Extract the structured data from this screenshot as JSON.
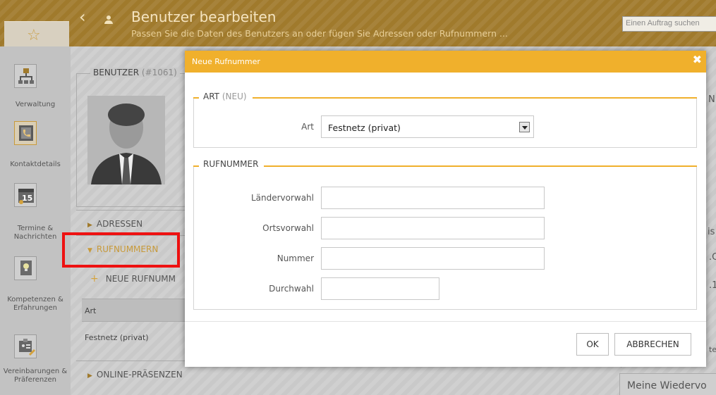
{
  "header": {
    "title": "Benutzer bearbeiten",
    "subtitle": "Passen Sie die Daten des Benutzers an oder fügen Sie Adressen oder Rufnummern ...",
    "search_placeholder": "Einen Auftrag suchen"
  },
  "sidebar": {
    "items": [
      {
        "label": "Verwaltung",
        "icon": "org-chart-icon"
      },
      {
        "label": "Kontaktdetails",
        "icon": "phone-book-icon"
      },
      {
        "label": "Termine & Nachrichten",
        "icon": "calendar-icon"
      },
      {
        "label": "Kompetenzen & Erfahrungen",
        "icon": "lightbulb-icon"
      },
      {
        "label": "Vereinbarungen & Präferenzen",
        "icon": "id-card-icon"
      }
    ]
  },
  "user_panel": {
    "label": "BENUTZER",
    "id": "(#1061)",
    "sections": {
      "adressen": "ADRESSEN",
      "rufnummern": "RUFNUMMERN",
      "online": "ONLINE-PRÄSENZEN"
    },
    "new_phone_label": "NEUE RUFNUMM",
    "table_header": "Art",
    "table_value": "Festnetz (privat)"
  },
  "right_panel": {
    "fragment_1": "NI",
    "fragment_2": "is",
    "fragment_3": ".C",
    "fragment_4": ".1",
    "fragment_5": "te",
    "bottom_label": "Meine Wiedervo"
  },
  "modal": {
    "title": "Neue Rufnummer",
    "section_art": {
      "title": "ART",
      "badge": "(NEU)"
    },
    "art_label": "Art",
    "art_value": "Festnetz (privat)",
    "section_rufnummer": {
      "title": "RUFNUMMER"
    },
    "fields": {
      "laendervorwahl": {
        "label": "Ländervorwahl",
        "value": ""
      },
      "ortsvorwahl": {
        "label": "Ortsvorwahl",
        "value": ""
      },
      "nummer": {
        "label": "Nummer",
        "value": ""
      },
      "durchwahl": {
        "label": "Durchwahl",
        "value": ""
      }
    },
    "ok_label": "OK",
    "cancel_label": "ABBRECHEN"
  },
  "colors": {
    "accent": "#f0b02c",
    "header_bg": "#a07a2c",
    "highlight_frame": "#ee1111"
  }
}
